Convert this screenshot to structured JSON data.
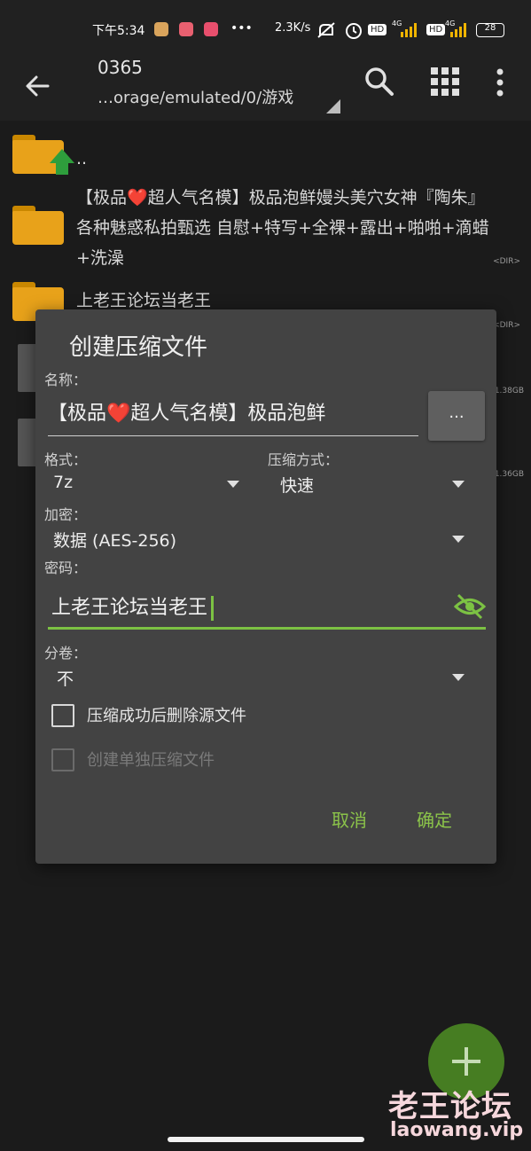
{
  "status_bar": {
    "time": "下午5:34",
    "more": "•••",
    "speed": "2.3K/s",
    "hd1": "HD",
    "signal1": "4G",
    "hd2": "HD",
    "signal2": "4G",
    "battery": "28"
  },
  "app_bar": {
    "title": "0365",
    "path": "…orage/emulated/0/游戏",
    "icons": [
      "back-arrow-icon",
      "search-icon",
      "grid-view-icon",
      "more-vert-icon"
    ]
  },
  "files": [
    {
      "name": "..",
      "icon": "folder-up-icon"
    },
    {
      "name": "【极品❤️超人气名模】极品泡鲜嫚头美穴女神『陶朱』各种魅惑私拍甄选 自慰+特写+全裸+露出+啪啪+滴蜡+洗澡",
      "tag": "<DIR>"
    },
    {
      "name": "上老王论坛当老王",
      "tag": "<DIR>"
    },
    {
      "size": "1.38GB"
    },
    {
      "size": "1.36GB"
    }
  ],
  "dialog": {
    "title": "创建压缩文件",
    "name_label": "名称：",
    "name_value": "【极品❤️超人气名模】极品泡鲜",
    "browse_button": "...",
    "format_label": "格式：",
    "format_value": "7z",
    "method_label": "压缩方式：",
    "method_value": "快速",
    "encrypt_label": "加密：",
    "encrypt_value": "数据 (AES-256)",
    "password_label": "密码：",
    "password_value": "上老王论坛当老王",
    "split_label": "分卷：",
    "split_value": "不",
    "delete_after_label": "压缩成功后删除源文件",
    "separate_archives_label": "创建单独压缩文件",
    "cancel_button": "取消",
    "ok_button": "确定"
  },
  "fab": {
    "icon": "plus-icon"
  },
  "watermark": {
    "line1": "老王论坛",
    "line2": "laowang.vip"
  },
  "colors": {
    "accent": "#8bc34a",
    "dialog_bg": "#434343",
    "background": "#1b1b1b",
    "fab": "#467d22",
    "folder": "#e8a21a"
  }
}
